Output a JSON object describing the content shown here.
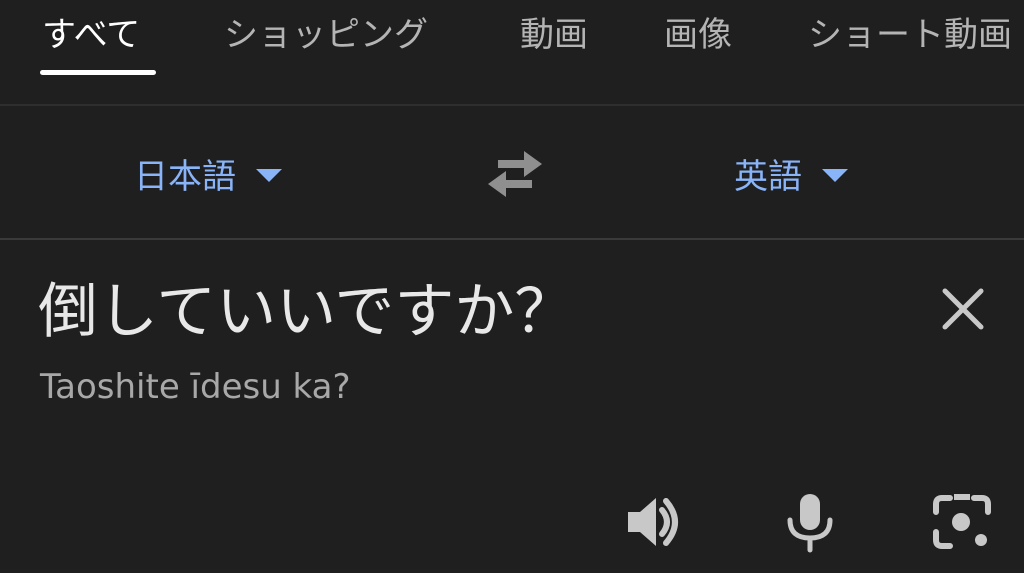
{
  "tabs": [
    {
      "label": "すべて",
      "active": true
    },
    {
      "label": "ショッピング",
      "active": false
    },
    {
      "label": "動画",
      "active": false
    },
    {
      "label": "画像",
      "active": false
    },
    {
      "label": "ショート動画",
      "active": false
    }
  ],
  "translator": {
    "source_lang": "日本語",
    "target_lang": "英語",
    "source_text": "倒していいですか？",
    "romanization": "Taoshite īdesu ka?",
    "icons": {
      "swap": "swap-arrows-icon",
      "clear": "close-icon",
      "speak": "speaker-icon",
      "voice": "microphone-icon",
      "camera": "lens-camera-icon"
    }
  },
  "colors": {
    "background": "#1f1f1f",
    "accent": "#8ab4f8",
    "text": "#e8e8e8",
    "muted": "#a8a8a8"
  }
}
